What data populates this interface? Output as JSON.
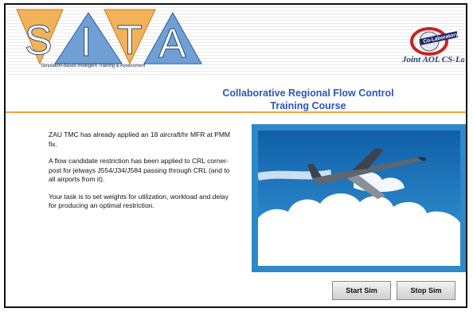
{
  "logo": {
    "letters": [
      "S",
      "I",
      "T",
      "A"
    ],
    "tagline": "Simulation-based Intelligent Training & Assessment"
  },
  "badge": {
    "top_text": "Co-Laboratory",
    "bottom_text": "Joint AOL CS-Lab"
  },
  "title": {
    "line1": "Collaborative Regional Flow Control",
    "line2": "Training Course"
  },
  "content": {
    "paragraphs": [
      "ZAU TMC has already applied an 18 aircraft/hr MFR at PMM fix.",
      "A flow candidate restriction has been applied to CRL corner-post for jetways J554/J34/J584 passing through CRL (and to all airports from it).",
      "Your task is to set weights for utilization, workload and delay for producing an optimal restriction."
    ]
  },
  "buttons": {
    "start": "Start Sim",
    "stop": "Stop Sim"
  },
  "colors": {
    "title_blue": "#2e55b8",
    "accent_orange": "#f2a43a",
    "sky_blue": "#2d89c7"
  },
  "icons": {
    "illustration": "airplane-icon"
  }
}
